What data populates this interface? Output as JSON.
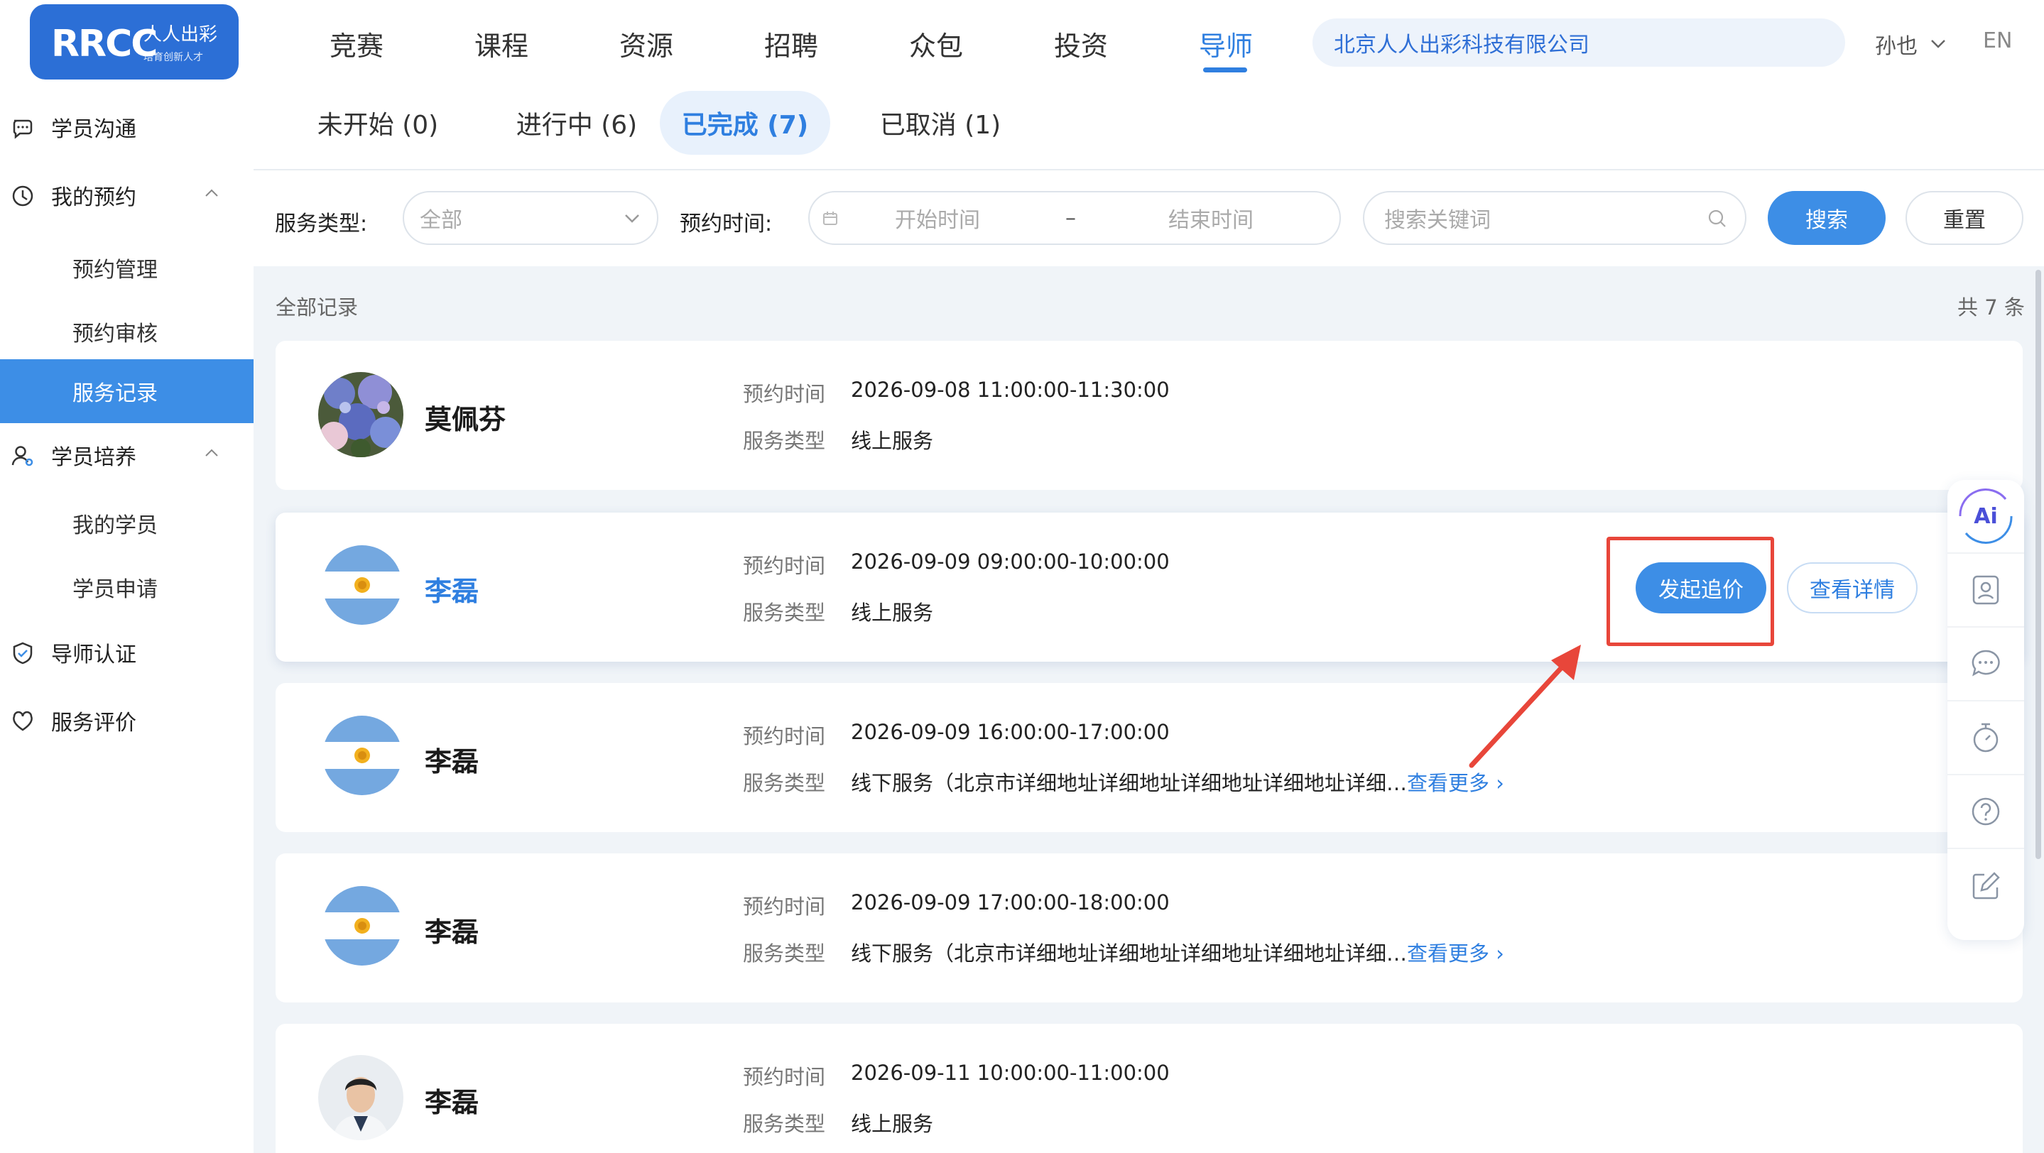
{
  "logo": {
    "brand": "RRCC",
    "cn": "人人出彩",
    "tagline": "培育创新人才"
  },
  "nav": [
    "竞赛",
    "课程",
    "资源",
    "招聘",
    "众包",
    "投资",
    "导师"
  ],
  "company": "北京人人出彩科技有限公司",
  "user": {
    "name": "孙也",
    "lang": "EN"
  },
  "sidebar": {
    "items": [
      {
        "label": "学员沟通",
        "icon": "chat-icon"
      },
      {
        "label": "我的预约",
        "icon": "clock-icon",
        "expanded": true,
        "children": [
          "预约管理",
          "预约审核",
          "服务记录"
        ]
      },
      {
        "label": "学员培养",
        "icon": "user-icon",
        "expanded": true,
        "children": [
          "我的学员",
          "学员申请"
        ]
      },
      {
        "label": "导师认证",
        "icon": "shield-icon"
      },
      {
        "label": "服务评价",
        "icon": "heart-icon"
      }
    ],
    "active": "服务记录"
  },
  "tabs": [
    "未开始 (0)",
    "进行中 (6)",
    "已完成 (7)",
    "已取消 (1)"
  ],
  "active_tab": "已完成 (7)",
  "filters": {
    "type_label": "服务类型:",
    "type_value": "全部",
    "time_label": "预约时间:",
    "start_placeholder": "开始时间",
    "range_sep": "–",
    "end_placeholder": "结束时间",
    "keyword_placeholder": "搜索关键词",
    "search": "搜索",
    "reset": "重置"
  },
  "list": {
    "title": "全部记录",
    "count": "共 7 条",
    "time_label": "预约时间",
    "type_label": "服务类型",
    "more_label": "查看更多",
    "chase_label": "发起追价",
    "detail_label": "查看详情",
    "records": [
      {
        "name": "莫佩芬",
        "time": "2026-09-08 11:00:00-11:30:00",
        "type": "线上服务",
        "avatar": "flowers"
      },
      {
        "name": "李磊",
        "time": "2026-09-09 09:00:00-10:00:00",
        "type": "线上服务",
        "avatar": "flag"
      },
      {
        "name": "李磊",
        "time": "2026-09-09 16:00:00-17:00:00",
        "type": "线下服务（北京市详细地址详细地址详细地址详细地址详细…",
        "avatar": "flag"
      },
      {
        "name": "李磊",
        "time": "2026-09-09 17:00:00-18:00:00",
        "type": "线下服务（北京市详细地址详细地址详细地址详细地址详细…",
        "avatar": "flag"
      },
      {
        "name": "李磊",
        "time": "2026-09-11 10:00:00-11:00:00",
        "type": "线上服务",
        "avatar": "person"
      }
    ]
  },
  "toolbar": {
    "ai": "Ai",
    "tools": [
      "contact-card-icon",
      "message-icon",
      "timer-icon",
      "help-icon",
      "edit-icon"
    ]
  },
  "colors": {
    "primary": "#3d8ee6",
    "highlight": "#e8463a"
  }
}
